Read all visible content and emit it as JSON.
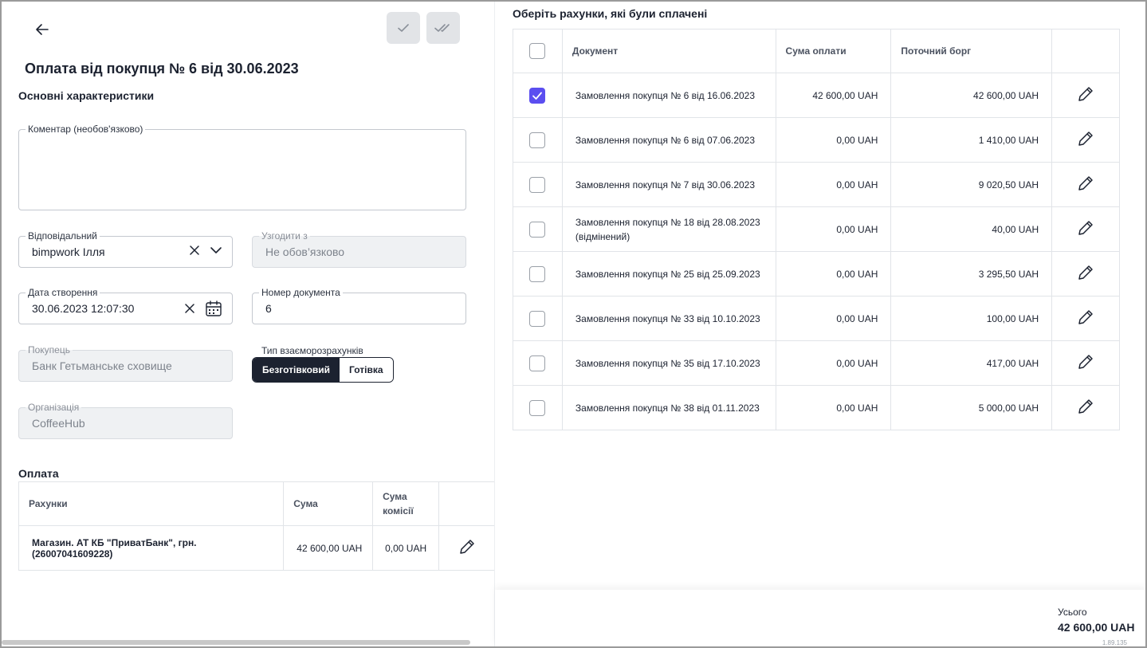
{
  "header": {
    "title": "Оплата від покупця № 6 від 30.06.2023"
  },
  "sections": {
    "main": "Основні характеристики",
    "payment": "Оплата"
  },
  "form": {
    "comment": {
      "label": "Коментар (необов'язково)",
      "value": ""
    },
    "responsible": {
      "label": "Відповідальний",
      "value": "bimpwork Ілля"
    },
    "approve_with": {
      "label": "Узгодити з",
      "placeholder": "Не обов’язково"
    },
    "created_date": {
      "label": "Дата створення",
      "value": "30.06.2023 12:07:30"
    },
    "doc_number": {
      "label": "Номер документа",
      "value": "6"
    },
    "buyer": {
      "label": "Покупець",
      "value": "Банк Гетьманське сховище"
    },
    "settlement_type": {
      "label": "Тип взаєморозрахунків",
      "options": [
        "Безготівковий",
        "Готівка"
      ],
      "selected": "Безготівковий"
    },
    "organization": {
      "label": "Організація",
      "value": "CoffeeHub"
    }
  },
  "payment_table": {
    "headers": [
      "Рахунки",
      "Сума",
      "Сума комісії"
    ],
    "rows": [
      {
        "account": "Магазин. АТ КБ \"ПриватБанк\", грн. (26007041609228)",
        "sum": "42 600,00 UAH",
        "commission": "0,00 UAH"
      }
    ]
  },
  "invoices": {
    "title": "Оберіть рахунки, які були сплачені",
    "headers": [
      "Документ",
      "Сума оплати",
      "Поточний борг"
    ],
    "rows": [
      {
        "checked": true,
        "document": "Замовлення покупця № 6 від 16.06.2023",
        "paid": "42 600,00 UAH",
        "debt": "42 600,00 UAH"
      },
      {
        "checked": false,
        "document": "Замовлення покупця № 6 від 07.06.2023",
        "paid": "0,00 UAH",
        "debt": "1 410,00 UAH"
      },
      {
        "checked": false,
        "document": "Замовлення покупця № 7 від 30.06.2023",
        "paid": "0,00 UAH",
        "debt": "9 020,50 UAH"
      },
      {
        "checked": false,
        "document": "Замовлення покупця № 18 від 28.08.2023 (відмінений)",
        "paid": "0,00 UAH",
        "debt": "40,00 UAH"
      },
      {
        "checked": false,
        "document": "Замовлення покупця № 25 від 25.09.2023",
        "paid": "0,00 UAH",
        "debt": "3 295,50 UAH"
      },
      {
        "checked": false,
        "document": "Замовлення покупця № 33 від 10.10.2023",
        "paid": "0,00 UAH",
        "debt": "100,00 UAH"
      },
      {
        "checked": false,
        "document": "Замовлення покупця № 35 від 17.10.2023",
        "paid": "0,00 UAH",
        "debt": "417,00 UAH"
      },
      {
        "checked": false,
        "document": "Замовлення покупця № 38 від 01.11.2023",
        "paid": "0,00 UAH",
        "debt": "5 000,00 UAH"
      }
    ]
  },
  "footer": {
    "total_label": "Усього",
    "total_value": "42 600,00 UAH",
    "version": "1.89.135"
  },
  "colors": {
    "accent": "#5b4ef0",
    "dark": "#1c2230"
  }
}
